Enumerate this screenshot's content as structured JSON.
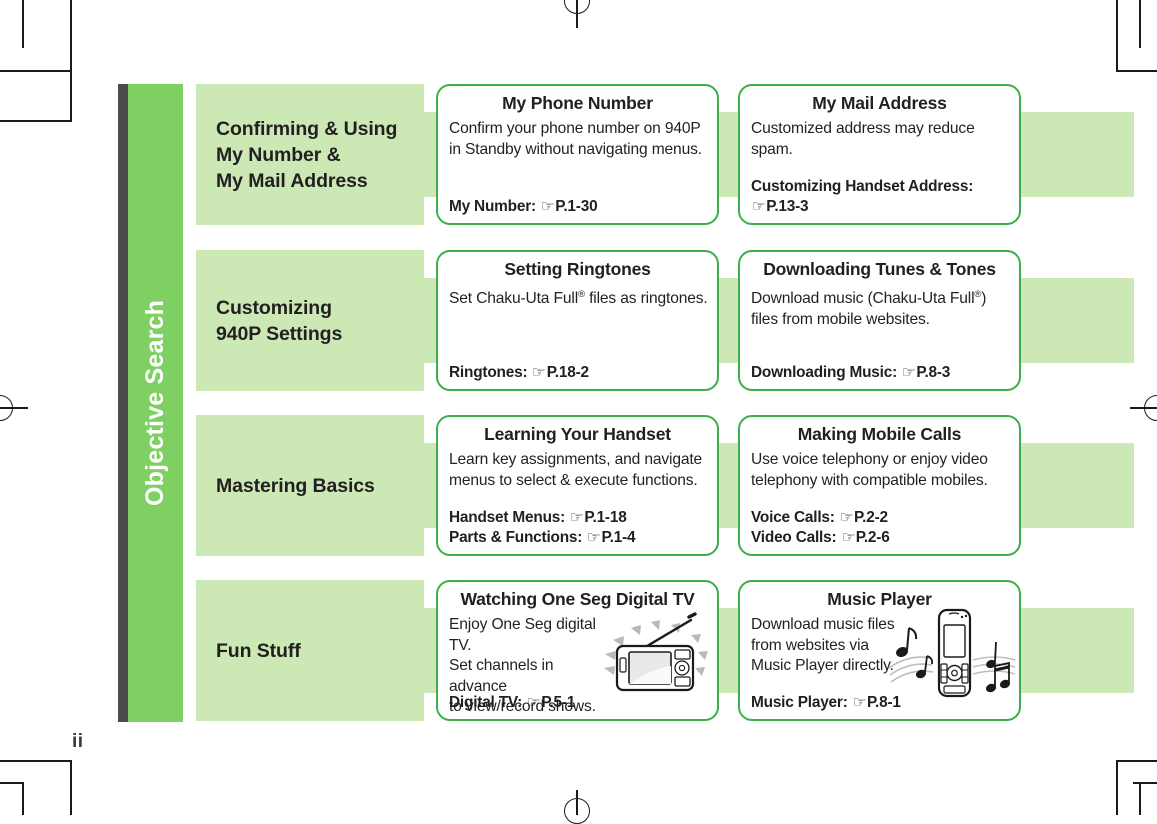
{
  "page": {
    "number": "ii",
    "sidebar_title": "Objective Search",
    "colors": {
      "sidebar_dark": "#4b4b4d",
      "sidebar_green": "#7ed063",
      "band_light_green": "#cbe8b5",
      "card_border_green": "#3dae49",
      "text": "#231f20"
    }
  },
  "rows": [
    {
      "category": "Confirming & Using\nMy Number &\nMy Mail Address",
      "category_lines": [
        "Confirming & Using",
        "My Number &",
        "My Mail Address"
      ],
      "cards": [
        {
          "title": "My Phone Number",
          "body_lines": [
            "Confirm your phone number on 940P",
            "in Standby without navigating menus."
          ],
          "links": [
            {
              "label": "My Number:",
              "icon": "pointing-hand-icon",
              "page_ref": "P.1-30"
            }
          ],
          "illustration": null
        },
        {
          "title": "My Mail Address",
          "body_lines": [
            "Customized address may reduce spam."
          ],
          "links": [
            {
              "label": "Customizing Handset Address:",
              "icon": "pointing-hand-icon",
              "page_ref": "P.13-3",
              "wrap": true
            }
          ],
          "illustration": null
        }
      ]
    },
    {
      "category": "Customizing\n940P Settings",
      "category_lines": [
        "Customizing",
        "940P Settings"
      ],
      "cards": [
        {
          "title": "Setting Ringtones",
          "body_lines": [
            "Set Chaku-Uta Full® files as ringtones."
          ],
          "links": [
            {
              "label": "Ringtones:",
              "icon": "pointing-hand-icon",
              "page_ref": "P.18-2"
            }
          ],
          "illustration": null
        },
        {
          "title": "Downloading Tunes & Tones",
          "body_lines": [
            "Download music (Chaku-Uta Full®)",
            "files from mobile websites."
          ],
          "links": [
            {
              "label": "Downloading Music:",
              "icon": "pointing-hand-icon",
              "page_ref": "P.8-3"
            }
          ],
          "illustration": null
        }
      ]
    },
    {
      "category": "Mastering Basics",
      "category_lines": [
        "Mastering Basics"
      ],
      "cards": [
        {
          "title": "Learning Your Handset",
          "body_lines": [
            "Learn key assignments, and navigate",
            "menus to select & execute functions."
          ],
          "links": [
            {
              "label": "Handset Menus:",
              "icon": "pointing-hand-icon",
              "page_ref": "P.1-18"
            },
            {
              "label": "Parts & Functions:",
              "icon": "pointing-hand-icon",
              "page_ref": "P.1-4"
            }
          ],
          "illustration": null
        },
        {
          "title": "Making Mobile Calls",
          "body_lines": [
            "Use voice telephony or enjoy video",
            "telephony with compatible mobiles."
          ],
          "links": [
            {
              "label": "Voice Calls:",
              "icon": "pointing-hand-icon",
              "page_ref": "P.2-2"
            },
            {
              "label": "Video Calls:",
              "icon": "pointing-hand-icon",
              "page_ref": "P.2-6"
            }
          ],
          "illustration": null
        }
      ]
    },
    {
      "category": "Fun Stuff",
      "category_lines": [
        "Fun Stuff"
      ],
      "cards": [
        {
          "title": "Watching One Seg Digital TV",
          "body_lines": [
            "Enjoy One Seg digital TV.",
            "Set channels in advance",
            "to view/record shows."
          ],
          "links": [
            {
              "label": "Digital TV:",
              "icon": "pointing-hand-icon",
              "page_ref": "P.5-1"
            }
          ],
          "illustration": "handset-tv-antenna-illustration"
        },
        {
          "title": "Music Player",
          "body_lines": [
            "Download music files",
            "from websites via",
            "Music Player directly."
          ],
          "links": [
            {
              "label": "Music Player:",
              "icon": "pointing-hand-icon",
              "page_ref": "P.8-1"
            }
          ],
          "illustration": "handset-music-notes-illustration"
        }
      ]
    }
  ]
}
